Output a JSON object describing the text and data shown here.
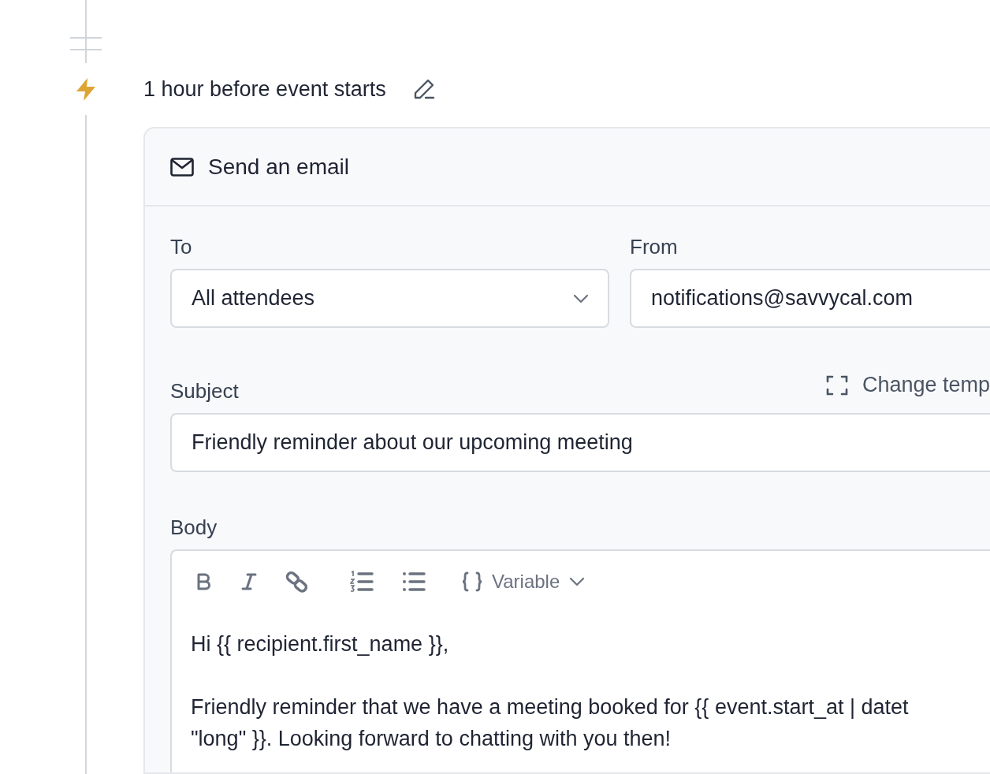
{
  "trigger": {
    "label": "1 hour before event starts"
  },
  "action": {
    "title": "Send an email",
    "to": {
      "label": "To",
      "value": "All attendees"
    },
    "from": {
      "label": "From",
      "value": "notifications@savvycal.com"
    },
    "subject": {
      "label": "Subject",
      "value": "Friendly reminder about our upcoming meeting",
      "template_link": "Change temp"
    },
    "body": {
      "label": "Body",
      "toolbar": [
        {
          "kind": "bold"
        },
        {
          "kind": "italic"
        },
        {
          "kind": "link"
        },
        {
          "kind": "ordered-list"
        },
        {
          "kind": "bullet-list"
        },
        {
          "kind": "variable",
          "label": "Variable"
        }
      ],
      "paragraphs": [
        [
          "Hi {{ recipient.first_name }},"
        ],
        [
          "Friendly reminder that we have a meeting booked for {{ event.start_at | datet",
          "\"long\" }}. Looking forward to chatting with you then!"
        ]
      ]
    }
  }
}
